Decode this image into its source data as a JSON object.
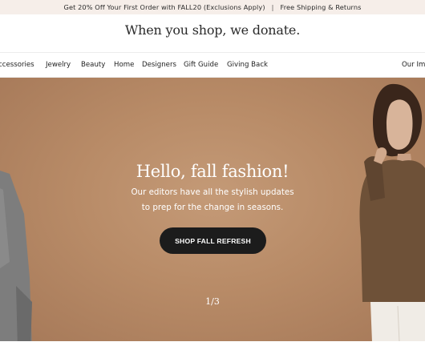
{
  "promo": {
    "offer": "Get 20% Off Your First Order with FALL20 (Exclusions Apply)",
    "separator": "|",
    "shipping": "Free Shipping & Returns"
  },
  "brand": {
    "tagline": "When you shop, we donate."
  },
  "nav": {
    "items": [
      "ccessories",
      "Jewelry",
      "Beauty",
      "Home",
      "Designers",
      "Gift Guide",
      "Giving Back"
    ],
    "right": "Our Imp"
  },
  "hero": {
    "title": "Hello, fall fashion!",
    "subtitle_line1": "Our editors have all the stylish updates",
    "subtitle_line2": "to prep for the change in seasons.",
    "cta": "SHOP FALL REFRESH",
    "slide_counter": "1/3",
    "background_color": "#b88b67"
  }
}
